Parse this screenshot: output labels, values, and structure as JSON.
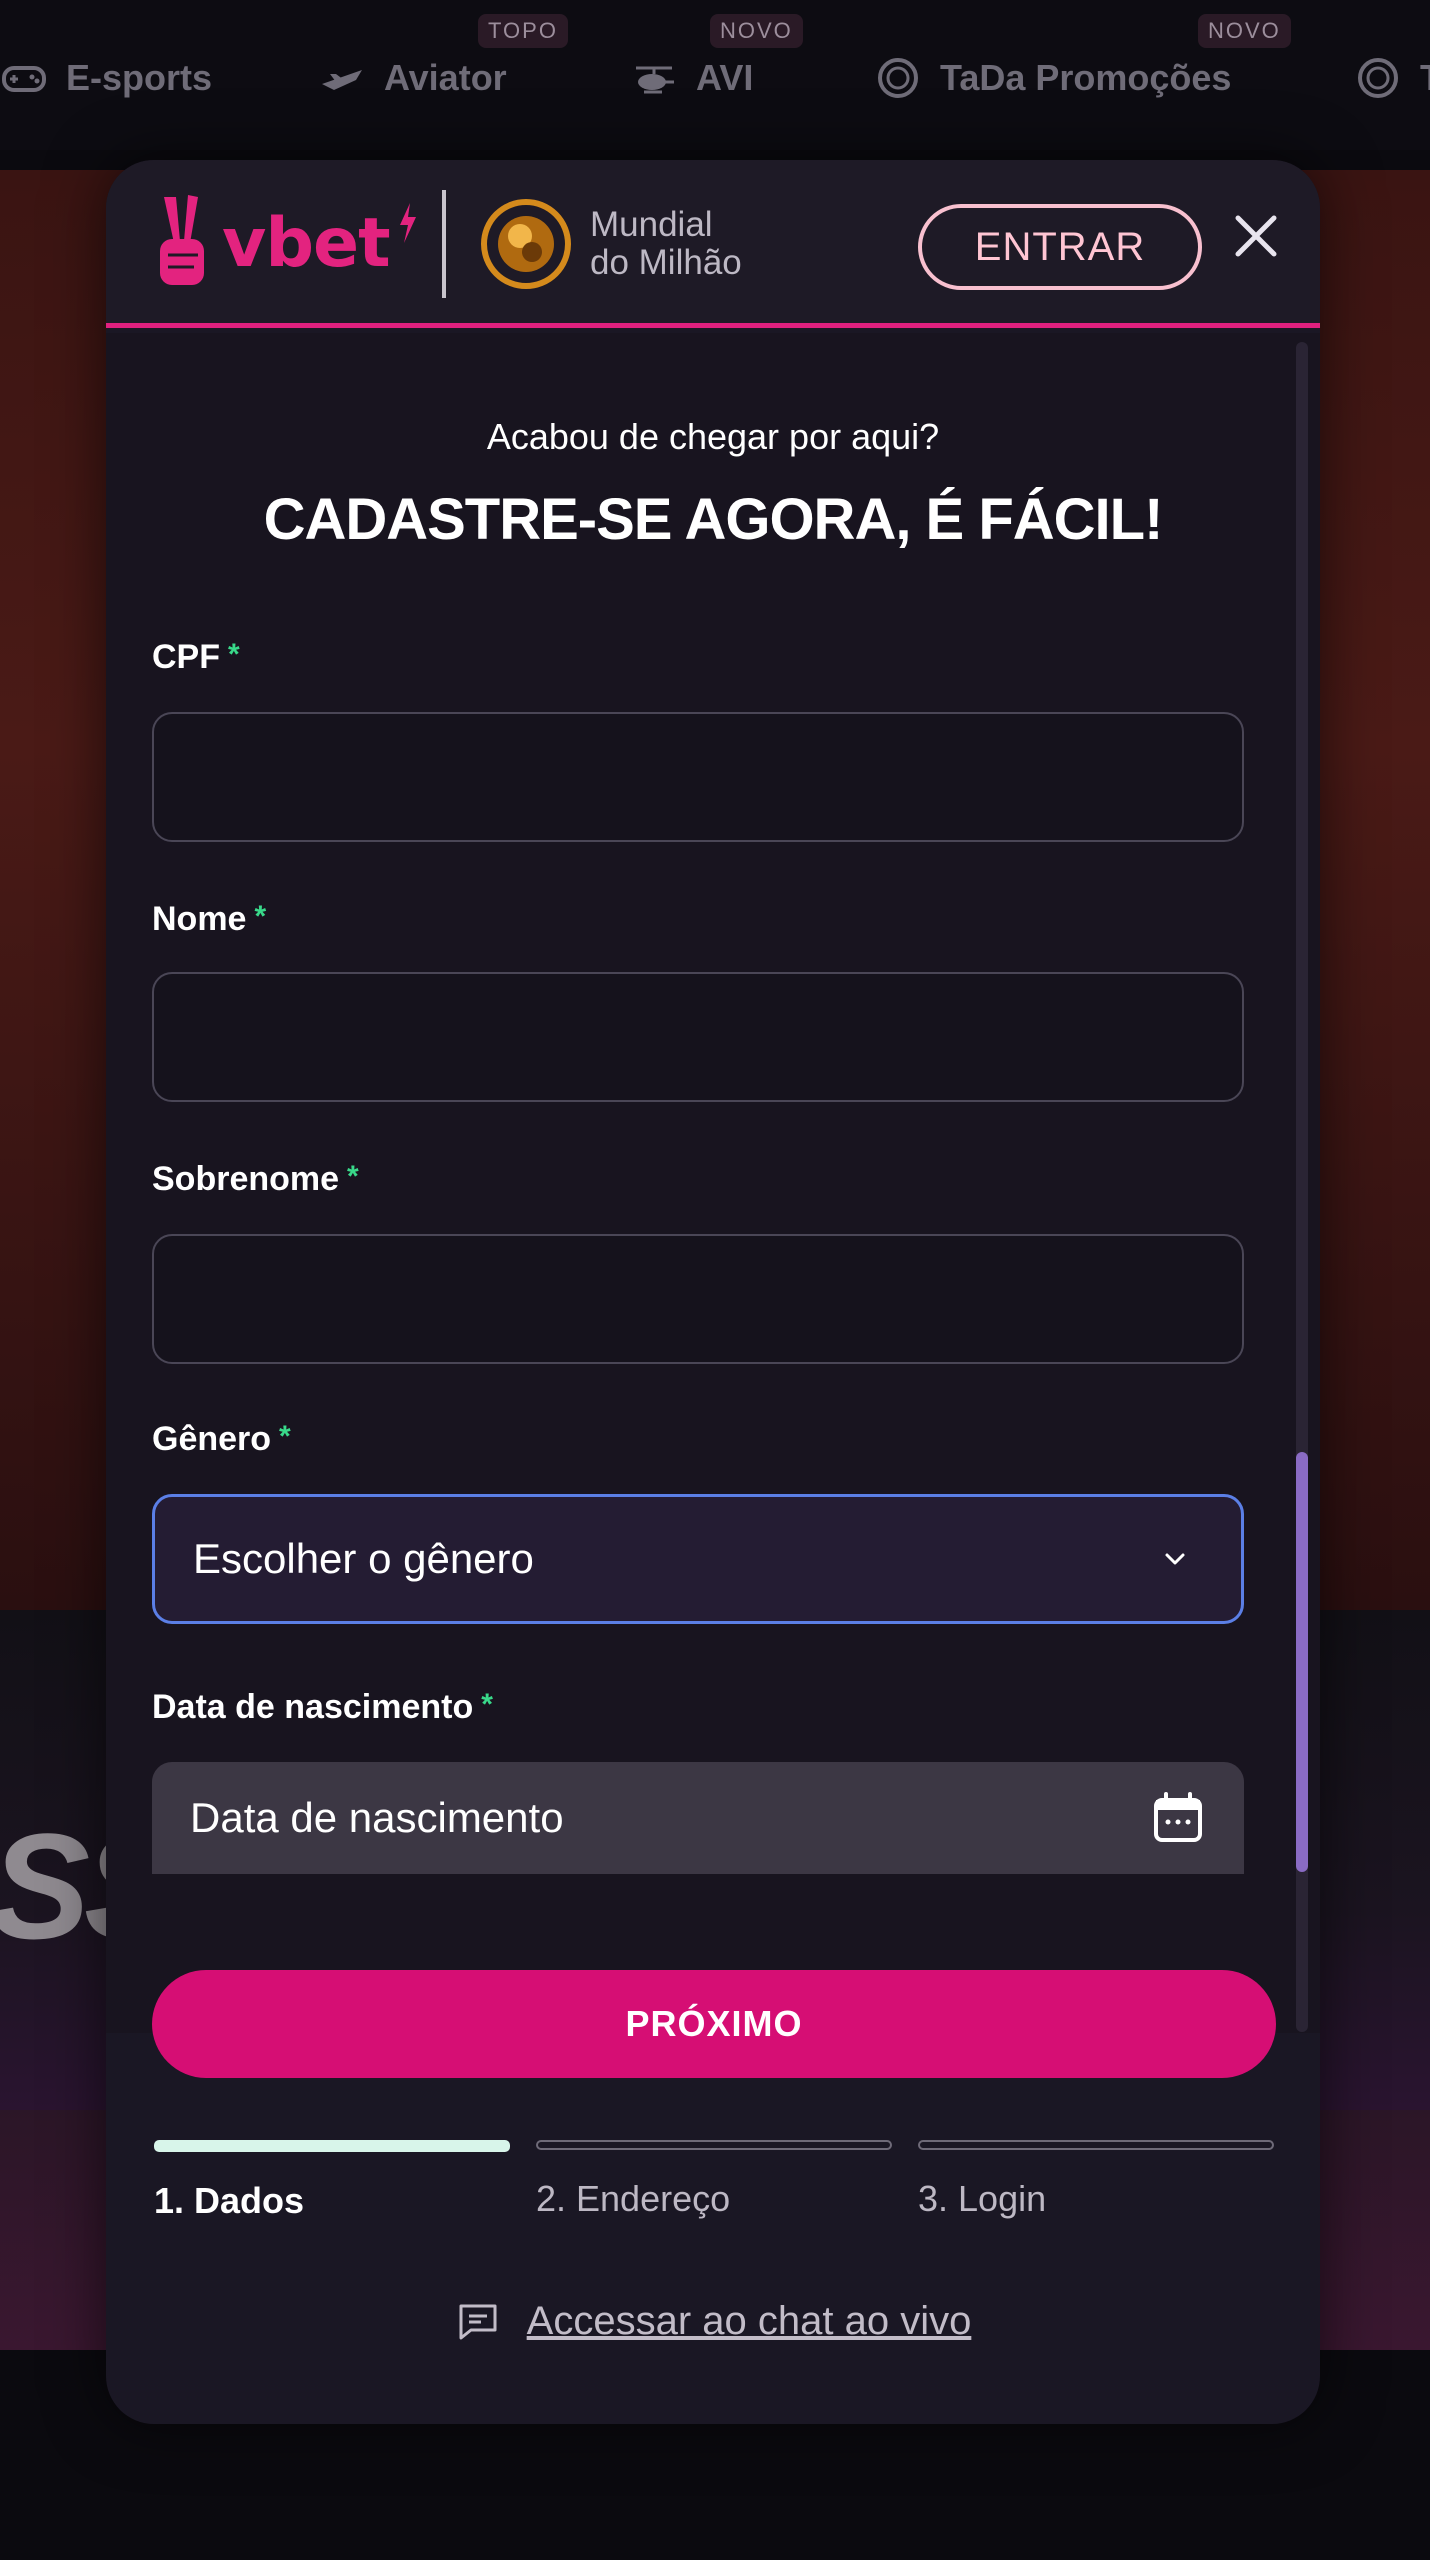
{
  "nav": {
    "items": [
      {
        "label": "E-sports",
        "icon": "gamepad-icon",
        "badge": ""
      },
      {
        "label": "Aviator",
        "icon": "airplane-icon",
        "badge": "TOPO"
      },
      {
        "label": "AVI",
        "icon": "helicopter-icon",
        "badge": "NOVO"
      },
      {
        "label": "TaDa Promoções",
        "icon": "coin-icon",
        "badge": "NOVO"
      }
    ],
    "overflow_label": "T"
  },
  "background": {
    "big_text": "SSI"
  },
  "modal": {
    "brand": "vbet",
    "partner": {
      "line1": "Mundial",
      "line2": "do Milhão"
    },
    "login_button": "ENTRAR",
    "close_icon": "close-icon",
    "subtitle": "Acabou de chegar por aqui?",
    "headline": "CADASTRE-SE AGORA, É FÁCIL!",
    "fields": {
      "cpf": {
        "label": "CPF",
        "required": "*",
        "value": ""
      },
      "nome": {
        "label": "Nome",
        "required": "*",
        "value": ""
      },
      "sobrenome": {
        "label": "Sobrenome",
        "required": "*",
        "value": ""
      },
      "genero": {
        "label": "Gênero",
        "required": "*",
        "selected": "Escolher o gênero",
        "icon": "chevron-down-icon"
      },
      "nascimento": {
        "label": "Data de nascimento",
        "required": "*",
        "placeholder": "Data de nascimento",
        "icon": "calendar-icon"
      }
    },
    "next_button": "PRÓXIMO",
    "steps": [
      {
        "label": "1. Dados",
        "active": true
      },
      {
        "label": "2. Endereço",
        "active": false
      },
      {
        "label": "3. Login",
        "active": false
      }
    ],
    "chat": {
      "label": "Accessar ao chat ao vivo",
      "icon": "chat-icon"
    }
  },
  "colors": {
    "accent": "#d60e74",
    "brand_pink": "#e3237f",
    "required_star": "#39d98a",
    "focus_border": "#5b7fe6",
    "active_step": "#d8f5ea"
  }
}
